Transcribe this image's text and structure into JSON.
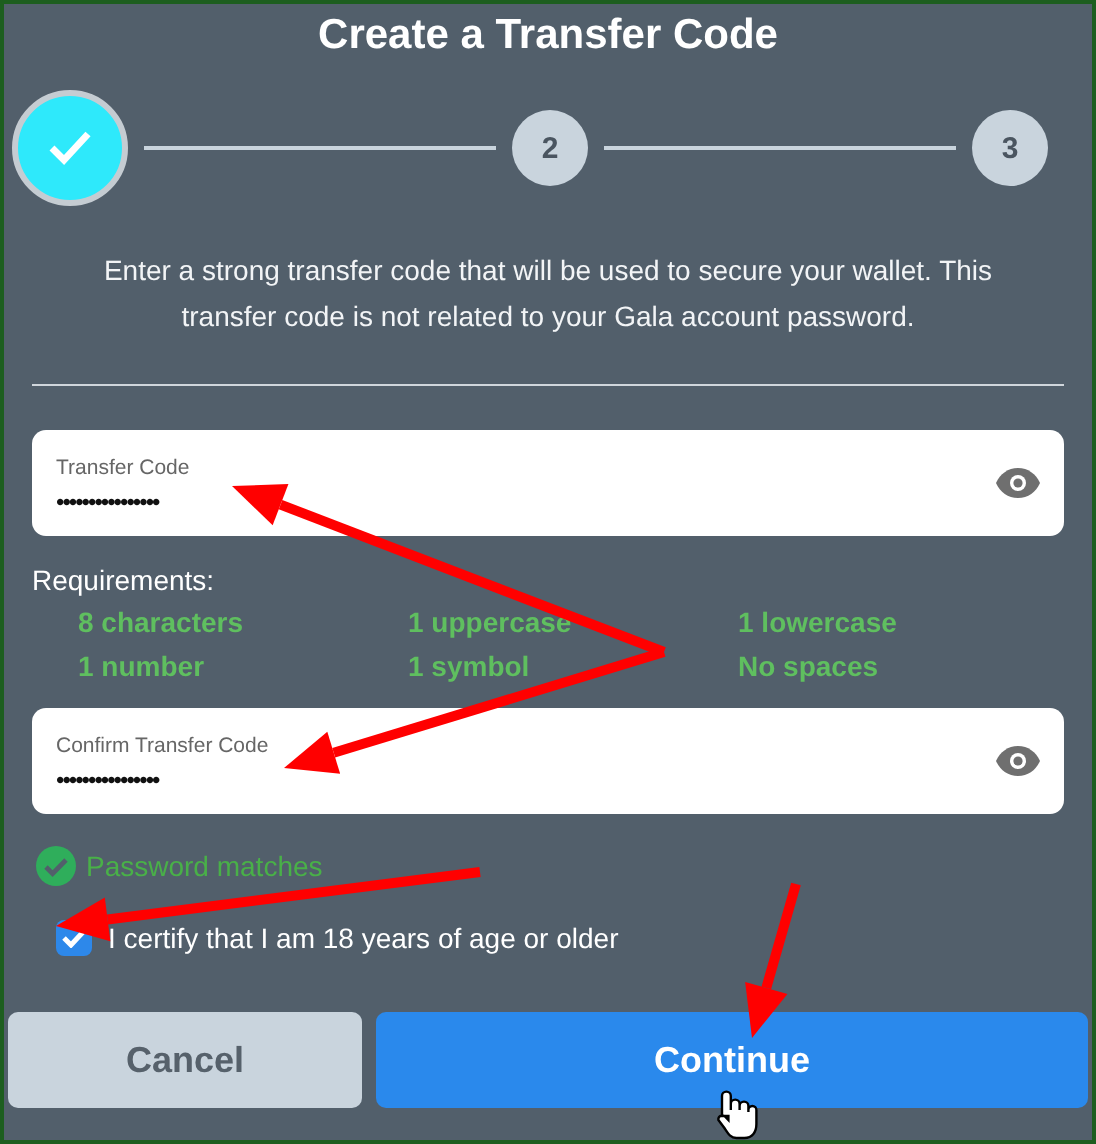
{
  "title": "Create a Transfer Code",
  "steps": [
    {
      "completed": true
    },
    {
      "label": "2",
      "completed": false
    },
    {
      "label": "3",
      "completed": false
    }
  ],
  "description": "Enter a strong transfer code that will be used to secure your wallet. This transfer code is not related to your Gala account password.",
  "fields": [
    {
      "label": "Transfer Code",
      "value": "••••••••••••••••"
    },
    {
      "label": "Confirm Transfer Code",
      "value": "••••••••••••••••"
    }
  ],
  "requirements_title": "Requirements:",
  "requirements": [
    {
      "text": "8 characters",
      "met": true
    },
    {
      "text": "1 uppercase",
      "met": true
    },
    {
      "text": "1 lowercase",
      "met": true
    },
    {
      "text": "1 number",
      "met": true
    },
    {
      "text": "1 symbol",
      "met": true
    },
    {
      "text": "No spaces",
      "met": true
    }
  ],
  "match_status": {
    "text": "Password matches",
    "matched": true
  },
  "certify": {
    "text": "I certify that I am 18 years of age or older",
    "checked": true
  },
  "buttons": [
    {
      "label": "Cancel",
      "kind": "secondary"
    },
    {
      "label": "Continue",
      "kind": "primary"
    }
  ]
}
